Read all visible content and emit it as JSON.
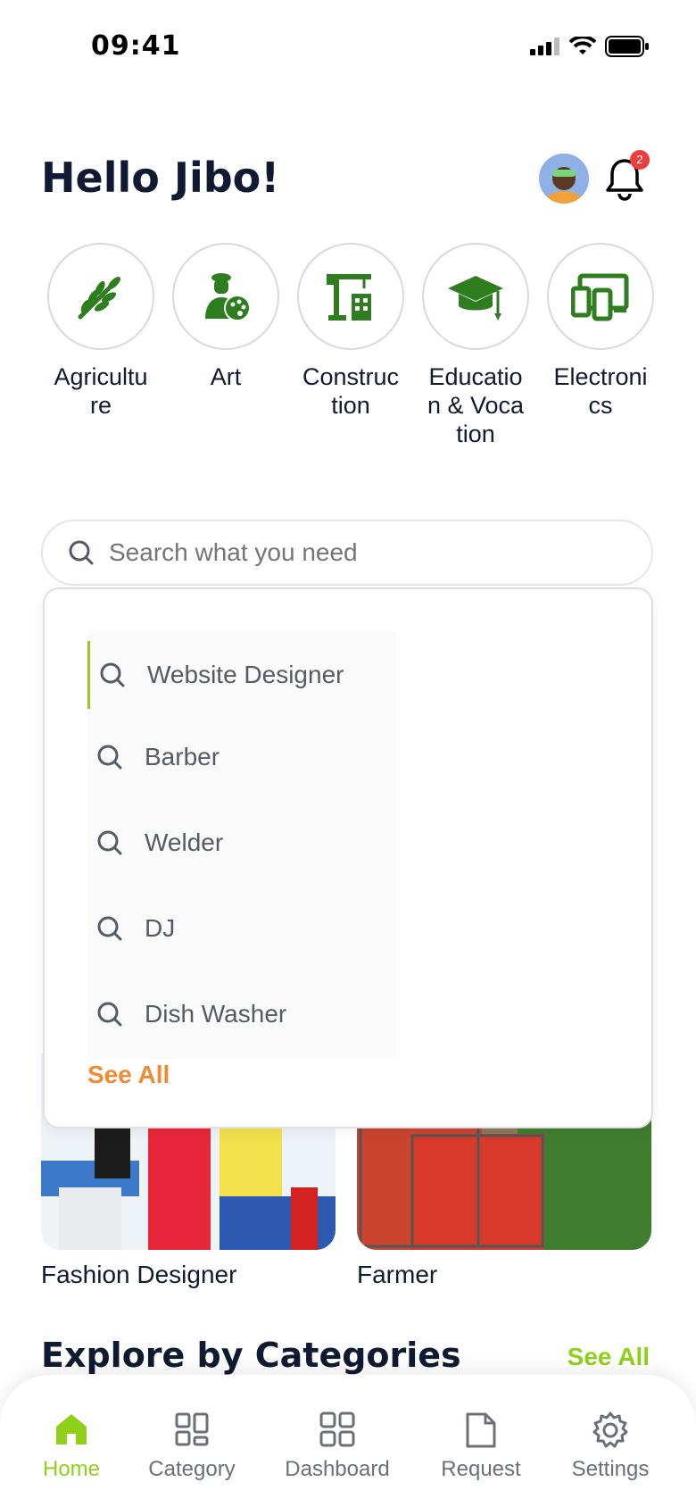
{
  "status_bar": {
    "time": "09:41"
  },
  "header": {
    "greeting": "Hello Jibo!",
    "notification_count": "2"
  },
  "categories": [
    {
      "label": "Agriculture",
      "icon": "wheat-icon"
    },
    {
      "label": "Art",
      "icon": "artist-palette-icon"
    },
    {
      "label": "Construction",
      "icon": "crane-icon"
    },
    {
      "label": "Education & Vocation",
      "icon": "graduation-cap-icon"
    },
    {
      "label": "Electronics",
      "icon": "devices-icon"
    }
  ],
  "search": {
    "placeholder": "Search what you need"
  },
  "dropdown": {
    "suggestions": [
      "Website Designer",
      "Barber",
      "Welder",
      "DJ",
      "Dish Washer"
    ],
    "see_all": "See All"
  },
  "featured": [
    {
      "label": "Fashion Designer"
    },
    {
      "label": "Farmer"
    }
  ],
  "explore": {
    "title": "Explore by Categories",
    "see_all": "See All"
  },
  "bottom_nav": [
    {
      "label": "Home",
      "icon": "home-icon",
      "active": true
    },
    {
      "label": "Category",
      "icon": "category-icon"
    },
    {
      "label": "Dashboard",
      "icon": "dashboard-icon"
    },
    {
      "label": "Request",
      "icon": "document-icon"
    },
    {
      "label": "Settings",
      "icon": "gear-icon"
    }
  ],
  "colors": {
    "brand_green": "#8fd11a",
    "accent_orange": "#f08a33",
    "icon_green": "#2e7d1f",
    "badge_red": "#ef3d3d"
  }
}
